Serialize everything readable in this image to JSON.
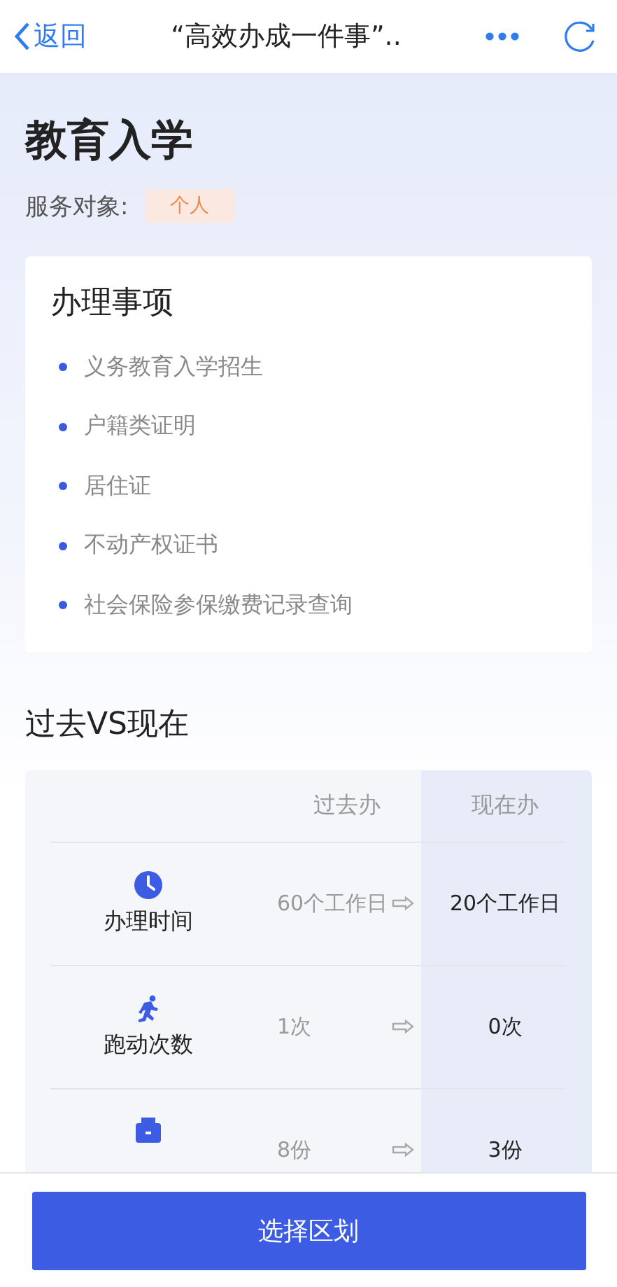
{
  "nav": {
    "back": "返回",
    "title": "“高效办成一件事”.."
  },
  "header": {
    "title": "教育入学",
    "service_label": "服务对象:",
    "service_tag": "个人"
  },
  "matters": {
    "title": "办理事项",
    "items": [
      "义务教育入学招生",
      "户籍类证明",
      "居住证",
      "不动产权证书",
      "社会保险参保缴费记录查询"
    ]
  },
  "comparison": {
    "title": "过去VS现在",
    "columns": [
      "过去办",
      "现在办"
    ],
    "rows": [
      {
        "kind": "time",
        "label": "办理时间",
        "past": "60个工作日",
        "now": "20个工作日"
      },
      {
        "kind": "trips",
        "label": "跑动次数",
        "past": "1次",
        "now": "0次"
      },
      {
        "kind": "materials",
        "past": "8份",
        "now": "3份"
      }
    ]
  },
  "footer": {
    "button": "选择区划"
  }
}
